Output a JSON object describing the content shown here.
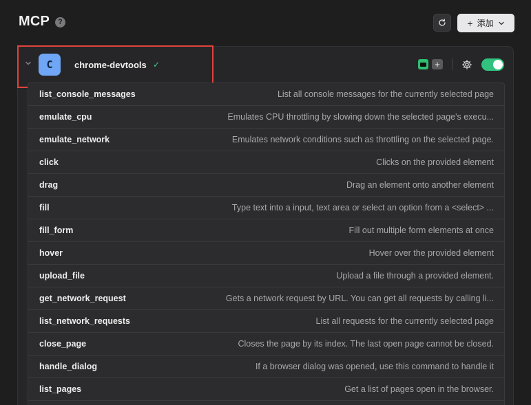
{
  "header": {
    "title": "MCP",
    "help_icon": "?",
    "refresh_icon": "refresh-icon",
    "add_button": {
      "icon": "plus",
      "label": "添加",
      "chevron": "chevron-down"
    }
  },
  "server": {
    "avatar_letter": "C",
    "name": "chrome-devtools",
    "status_icon": "✓",
    "enabled": true,
    "colors": {
      "avatar": "#6fa6f5",
      "toggle": "#30c27e",
      "check": "#4cc38a",
      "highlight": "#e0433b"
    }
  },
  "tools": [
    {
      "name": "list_console_messages",
      "description": "List all console messages for the currently selected page"
    },
    {
      "name": "emulate_cpu",
      "description": "Emulates CPU throttling by slowing down the selected page's execu..."
    },
    {
      "name": "emulate_network",
      "description": "Emulates network conditions such as throttling on the selected page."
    },
    {
      "name": "click",
      "description": "Clicks on the provided element"
    },
    {
      "name": "drag",
      "description": "Drag an element onto another element"
    },
    {
      "name": "fill",
      "description": "Type text into a input, text area or select an option from a <select> ..."
    },
    {
      "name": "fill_form",
      "description": "Fill out multiple form elements at once"
    },
    {
      "name": "hover",
      "description": "Hover over the provided element"
    },
    {
      "name": "upload_file",
      "description": "Upload a file through a provided element."
    },
    {
      "name": "get_network_request",
      "description": "Gets a network request by URL. You can get all requests by calling li..."
    },
    {
      "name": "list_network_requests",
      "description": "List all requests for the currently selected page"
    },
    {
      "name": "close_page",
      "description": "Closes the page by its index. The last open page cannot be closed."
    },
    {
      "name": "handle_dialog",
      "description": "If a browser dialog was opened, use this command to handle it"
    },
    {
      "name": "list_pages",
      "description": "Get a list of pages open in the browser."
    }
  ]
}
